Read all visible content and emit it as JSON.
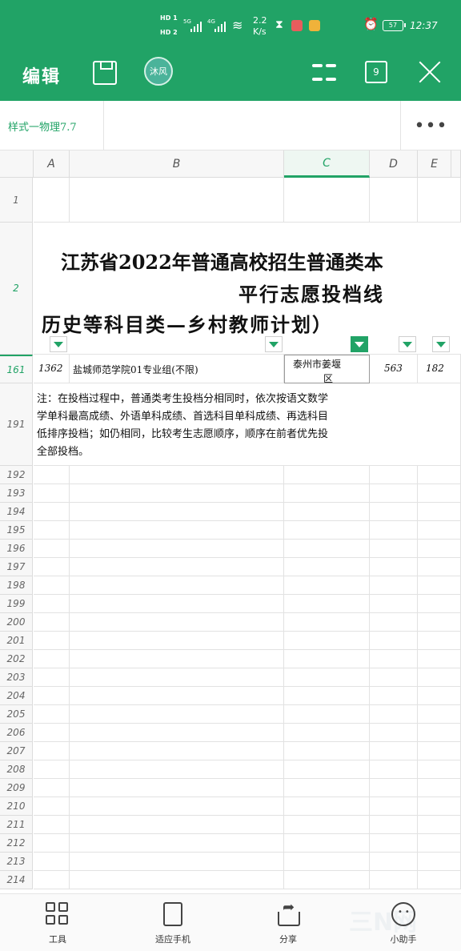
{
  "status": {
    "hd1": "HD 1",
    "hd2": "HD 2",
    "sig1": "5G",
    "sig2": "4G",
    "speed_value": "2.2",
    "speed_unit": "K/s",
    "battery": "57",
    "time": "12:37"
  },
  "toolbar": {
    "title": "编辑",
    "avatar": "沐风",
    "sheet_count": "9"
  },
  "sheet": {
    "name": "样式一物理7.7",
    "more": "•••"
  },
  "columns": [
    "A",
    "B",
    "C",
    "D",
    "E"
  ],
  "active_column": "C",
  "rows": {
    "r1": "1",
    "r2": "2",
    "r161": "161",
    "r191": "191",
    "empty": [
      "192",
      "193",
      "194",
      "195",
      "196",
      "197",
      "198",
      "199",
      "200",
      "201",
      "202",
      "203",
      "204",
      "205",
      "206",
      "207",
      "208",
      "209",
      "210",
      "211",
      "212",
      "213",
      "214"
    ]
  },
  "title": {
    "line1": "江苏省2022年普通高校招生普通类本",
    "line2": "平行志愿投档线",
    "line3": "历史等科目类—乡村教师计划）"
  },
  "row161": {
    "a": "1362",
    "b": "盐城师范学院01专业组(不限)",
    "c_line1": "泰州市姜堰",
    "c_line2": "区",
    "d": "563",
    "e": "182"
  },
  "note": {
    "line1": "注：在投档过程中，普通类考生投档分相同时，依次按语文数学",
    "line2": "学单科最高成绩、外语单科成绩、首选科目单科成绩、再选科目",
    "line3": "低排序投档；如仍相同，比较考生志愿顺序，顺序在前者优先投",
    "line4": "全部投档。"
  },
  "bottom": {
    "tools": "工具",
    "fit": "适应手机",
    "share": "分享",
    "helper": "小助手"
  },
  "colors": {
    "brand": "#21a366"
  }
}
